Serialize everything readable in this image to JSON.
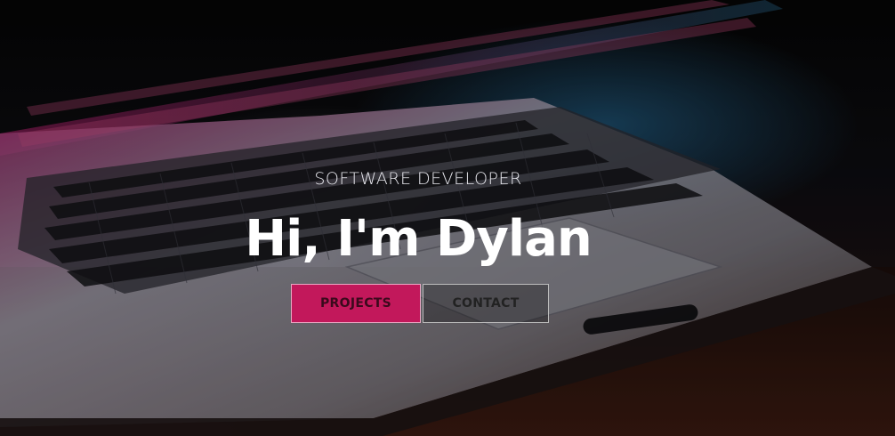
{
  "hero": {
    "subtitle": "SOFTWARE DEVELOPER",
    "title": "Hi, I'm Dylan",
    "background_image": "laptop-keyboard-photo"
  },
  "buttons": {
    "projects_label": "PROJECTS",
    "contact_label": "CONTACT"
  },
  "colors": {
    "primary_button": "#c2185b",
    "title_text": "#ffffff",
    "subtitle_text": "#e8e8ee"
  }
}
